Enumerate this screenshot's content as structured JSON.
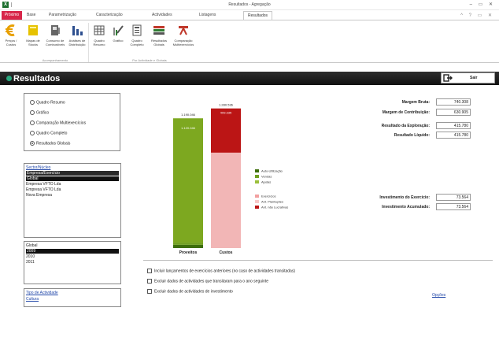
{
  "window": {
    "title": "Resultados - Agregação",
    "controls": "– ▭ ✕"
  },
  "tabs": {
    "file": "Próximo",
    "items": [
      "Base",
      "Parametrização",
      "Caracterização",
      "Actividades",
      "Listagens",
      "Resultados"
    ],
    "right_icons": "^ ? ▭ ✕"
  },
  "ribbon": {
    "buttons": [
      {
        "label": "Preços / Custos",
        "icon": "euro-icon",
        "color": "#e8a000"
      },
      {
        "label": "Mapas de Stocks",
        "icon": "map-icon",
        "color": "#e6c200"
      },
      {
        "label": "Consumo de Combustíveis",
        "icon": "fuel-icon",
        "color": "#666666"
      },
      {
        "label": "Análises de Distribuição",
        "icon": "bar-chart-icon",
        "color": "#2d4f8f"
      },
      {
        "label": "Quadro Resumo",
        "icon": "grid-icon",
        "color": "#555555"
      },
      {
        "label": "Gráfico",
        "icon": "pen-chart-icon",
        "color": "#888888"
      },
      {
        "label": "Quadro Completo",
        "icon": "table-icon",
        "color": "#555555"
      },
      {
        "label": "Resultados Globais",
        "icon": "results-icon",
        "color": "#c0392b"
      },
      {
        "label": "Comparação Multiexercícios",
        "icon": "compare-icon",
        "color": "#c0392b"
      }
    ],
    "groups": [
      "Acompanhamento",
      "Por Actividade e Globais"
    ]
  },
  "header": {
    "title": "Resultados",
    "exit_label": "Sair",
    "accent": "#2aa87e"
  },
  "view_options": [
    {
      "label": "Quadro Resumo",
      "checked": false
    },
    {
      "label": "Gráfico",
      "checked": false
    },
    {
      "label": "Comparação Multiexercícios",
      "checked": false
    },
    {
      "label": "Quadro Completo",
      "checked": false
    },
    {
      "label": "Resultados Globais",
      "checked": true
    }
  ],
  "entities": {
    "items": [
      {
        "label": "Sector/Núcleo",
        "style": "link"
      },
      {
        "label": "Empresa/Exercício",
        "style": "header"
      },
      {
        "label": "Global",
        "style": "selected"
      },
      {
        "label": "Empresa VFTO Lda",
        "style": "normal"
      },
      {
        "label": "Empresa VFTO Lda",
        "style": "normal"
      },
      {
        "label": "Nova Empresa",
        "style": "normal"
      }
    ]
  },
  "years": {
    "items": [
      {
        "label": "Global",
        "style": "normal"
      },
      {
        "label": "2009",
        "style": "selected"
      },
      {
        "label": "2010",
        "style": "normal"
      },
      {
        "label": "2011",
        "style": "normal"
      }
    ]
  },
  "activity_types": {
    "items": [
      {
        "label": "Tipo de Actividade",
        "style": "link"
      },
      {
        "label": "Cultura",
        "style": "link"
      }
    ]
  },
  "chart_data": {
    "type": "bar",
    "categories": [
      "Proveitos",
      "Custos"
    ],
    "totals": [
      "1.190.046",
      "1.280.536"
    ],
    "stacks": [
      [
        {
          "name": "Auto-Utilização",
          "value": 30000,
          "color": "#3d6e0b"
        },
        {
          "name": "Vendas",
          "value": 20000,
          "color": "#70a020"
        },
        {
          "name": "Ajudas",
          "value": 1140046,
          "color": "#7da820",
          "label": "1.120.046"
        }
      ],
      [
        {
          "name": "Exercícios",
          "value": 875000,
          "color": "#f2b6b6"
        },
        {
          "name": "Ant. Plantações",
          "value": 0,
          "color": "#f8d0d0"
        },
        {
          "name": "Ant. não Lucrativas",
          "value": 405536,
          "color": "#bb1515",
          "label": "409.335"
        }
      ]
    ],
    "legend": [
      {
        "name": "Auto-Utilização",
        "color": "#3d6e0b"
      },
      {
        "name": "Vendas",
        "color": "#70a020"
      },
      {
        "name": "Ajudas",
        "color": "#9bbf3a"
      },
      {
        "name": "Exercícios",
        "color": "#f2a0a0"
      },
      {
        "name": "Ant. Plantações",
        "color": "#f8c8c8"
      },
      {
        "name": "Ant. não Lucrativas",
        "color": "#bb1515"
      }
    ],
    "ylim": [
      0,
      1300000
    ],
    "grid": false,
    "legend_placement": "right"
  },
  "metrics": [
    {
      "label": "Margem Bruta:",
      "value": "740.308"
    },
    {
      "label": "Margem de Contribuição:",
      "value": "630.905"
    },
    {
      "label": "Resultado da Exploração:",
      "value": "415.780"
    },
    {
      "label": "Resultado Líquido:",
      "value": "415.780"
    }
  ],
  "investments": [
    {
      "label": "Investimento do Exercício:",
      "value": "73.564"
    },
    {
      "label": "Investimento Acumulado:",
      "value": "73.564"
    }
  ],
  "checks": [
    {
      "label": "Incluir lançamentos de exercícios anteriores (no caso de actividades transitadas)"
    },
    {
      "label": "Excluir dados de actividades que transitaram para o ano seguinte"
    },
    {
      "label": "Excluir dados de actividades de investimento"
    }
  ],
  "options_link": "Opções"
}
